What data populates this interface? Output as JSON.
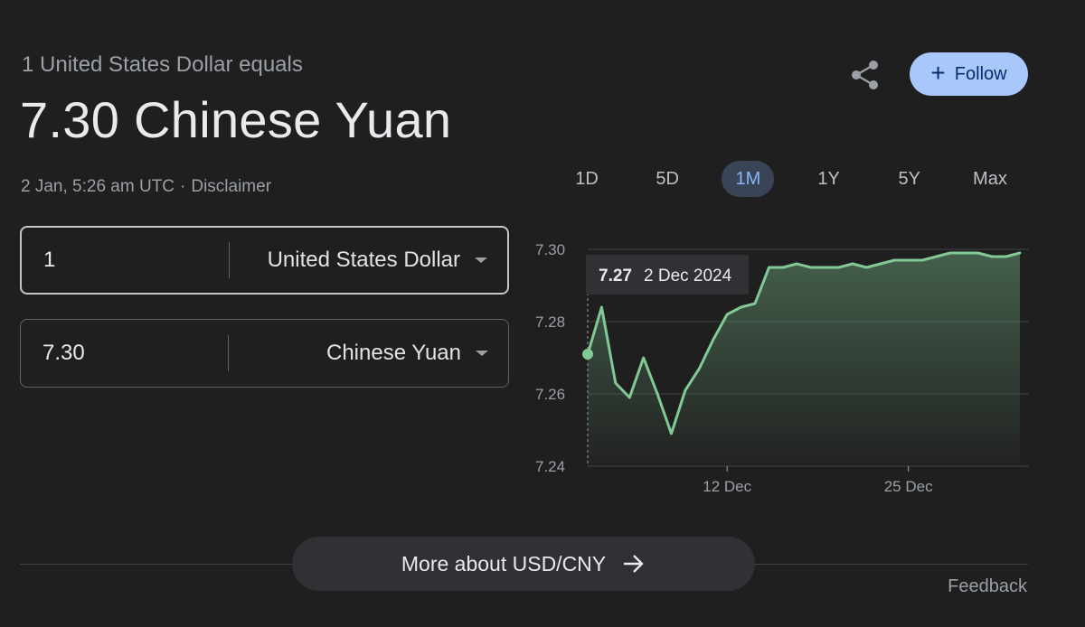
{
  "header": {
    "subtitle": "1 United States Dollar equals",
    "rate_text": "7.30 Chinese Yuan",
    "timestamp": "2 Jan, 5:26 am UTC",
    "separator": "·",
    "disclaimer": "Disclaimer"
  },
  "actions": {
    "share_icon": "share-icon",
    "follow_label": "Follow",
    "follow_icon": "plus-icon"
  },
  "converter": {
    "from_amount": "1",
    "from_currency": "United States Dollar",
    "to_amount": "7.30",
    "to_currency": "Chinese Yuan"
  },
  "ranges": {
    "items": [
      "1D",
      "5D",
      "1M",
      "1Y",
      "5Y",
      "Max"
    ],
    "active": "1M"
  },
  "tooltip": {
    "value": "7.27",
    "date": "2 Dec 2024"
  },
  "colors": {
    "line": "#81c995",
    "accent": "#a8c7fa",
    "active_tab": "#8ab4f8"
  },
  "chart_data": {
    "type": "area",
    "yticks": [
      "7.30",
      "7.28",
      "7.26",
      "7.24"
    ],
    "ylim": [
      7.24,
      7.3
    ],
    "xticks": [
      {
        "label": "12 Dec",
        "day": 12
      },
      {
        "label": "25 Dec",
        "day": 25
      }
    ],
    "grid": true,
    "series": [
      {
        "x": [
          2,
          3,
          4,
          5,
          6,
          7,
          8,
          9,
          10,
          11,
          12,
          13,
          14,
          15,
          16,
          17,
          18,
          19,
          20,
          21,
          22,
          23,
          24,
          25,
          26,
          27,
          28,
          29,
          30,
          31,
          32,
          33
        ],
        "values": [
          7.271,
          7.284,
          7.263,
          7.259,
          7.27,
          7.26,
          7.249,
          7.261,
          7.267,
          7.275,
          7.282,
          7.284,
          7.285,
          7.295,
          7.295,
          7.296,
          7.295,
          7.295,
          7.295,
          7.296,
          7.295,
          7.296,
          7.297,
          7.297,
          7.297,
          7.298,
          7.299,
          7.299,
          7.299,
          7.298,
          7.298,
          7.299
        ]
      }
    ]
  },
  "footer": {
    "more_label": "More about USD/CNY",
    "feedback": "Feedback"
  }
}
